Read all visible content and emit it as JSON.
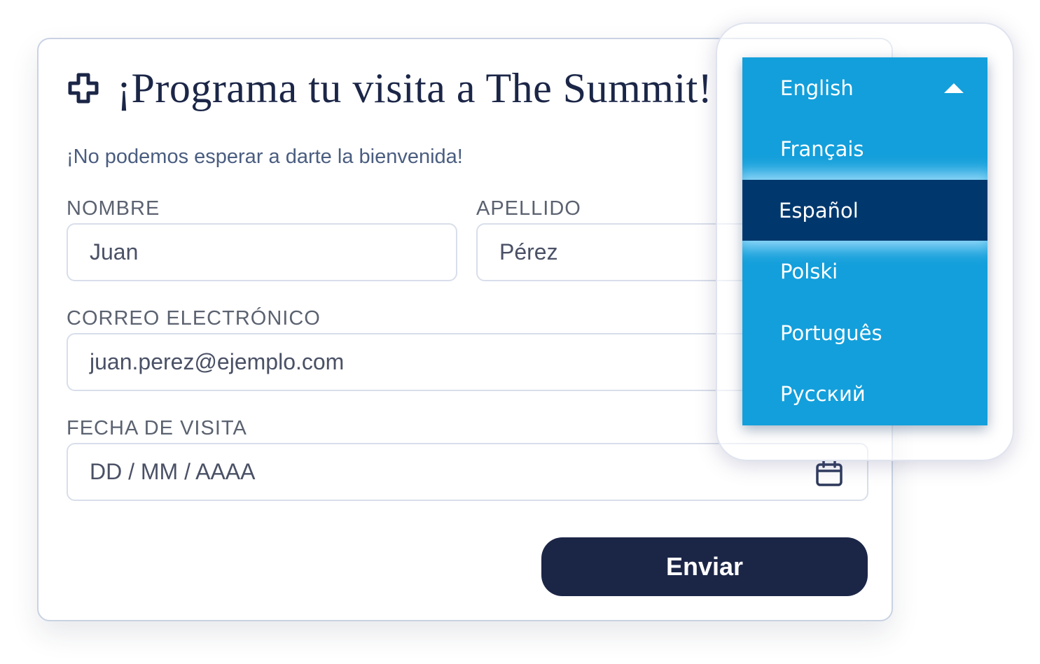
{
  "form": {
    "title": "¡Programa tu visita a The Summit!",
    "title_icon": "plus-cross-icon",
    "subtitle": "¡No podemos esperar a darte la bienvenida!",
    "fields": {
      "first_name": {
        "label": "NOMBRE",
        "value": "Juan"
      },
      "last_name": {
        "label": "APELLIDO",
        "value": "Pérez"
      },
      "email": {
        "label": "CORREO ELECTRÓNICO",
        "value": "juan.perez@ejemplo.com"
      },
      "visit_date": {
        "label": "FECHA DE VISITA",
        "placeholder": "DD / MM / AAAA",
        "icon": "calendar-icon"
      }
    },
    "submit_label": "Enviar"
  },
  "language_dropdown": {
    "options": [
      "English",
      "Français",
      "Español",
      "Polski",
      "Português",
      "Русский"
    ],
    "selected": "Español",
    "expanded_icon": "caret-up-icon"
  },
  "colors": {
    "navy": "#1b2647",
    "dropdown_bg": "#139fdb",
    "dropdown_selected": "#00386d",
    "field_border": "#d8deea",
    "card_border": "#c9d2e3"
  }
}
